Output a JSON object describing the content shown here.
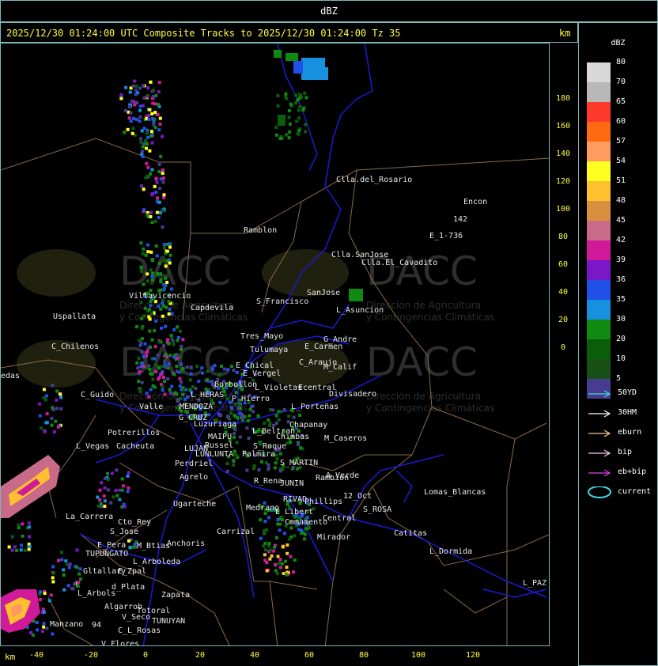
{
  "window": {
    "title": "dBZ"
  },
  "header": {
    "text": "2025/12/30 01:24:00 UTC Composite Tracks to 2025/12/30 01:24:00 Tz 35",
    "km_label": "km"
  },
  "axes": {
    "km_label_bottom": "km",
    "x_ticks": [
      "-40",
      "-20",
      "0",
      "20",
      "40",
      "60",
      "80",
      "100",
      "120"
    ],
    "y_ticks": [
      "180",
      "160",
      "140",
      "120",
      "100",
      "80",
      "60",
      "40",
      "20",
      "0"
    ]
  },
  "legend": {
    "title": "dBZ",
    "levels": [
      {
        "label": "80",
        "color": "#d8d8d8"
      },
      {
        "label": "70",
        "color": "#b8b8b8"
      },
      {
        "label": "65",
        "color": "#ff3a2a"
      },
      {
        "label": "60",
        "color": "#ff6a10"
      },
      {
        "label": "57",
        "color": "#ff9a60"
      },
      {
        "label": "54",
        "color": "#ffff20"
      },
      {
        "label": "51",
        "color": "#ffc030"
      },
      {
        "label": "48",
        "color": "#d89040"
      },
      {
        "label": "45",
        "color": "#c86a88"
      },
      {
        "label": "42",
        "color": "#d01a9a"
      },
      {
        "label": "39",
        "color": "#7a18c8"
      },
      {
        "label": "36",
        "color": "#2050e8"
      },
      {
        "label": "35",
        "color": "#1890e0"
      },
      {
        "label": "30",
        "color": "#108a10"
      },
      {
        "label": "20",
        "color": "#0a5e0a"
      },
      {
        "label": "10",
        "color": "#185018"
      },
      {
        "label": "5",
        "color": "#483c90"
      }
    ],
    "tracks": [
      {
        "label": "50YD",
        "color": "#40d8e0",
        "icon": "arrow-right-icon"
      },
      {
        "label": "30HM",
        "color": "#ffffff",
        "icon": "arrow-right-icon"
      },
      {
        "label": "eburn",
        "color": "#f0c890",
        "icon": "arrow-right-icon"
      },
      {
        "label": "bip",
        "color": "#ffc8e8",
        "icon": "arrow-right-icon"
      },
      {
        "label": "eb+bip",
        "color": "#e040e0",
        "icon": "arrow-right-icon"
      },
      {
        "label": "current",
        "color": "#40d8e0",
        "icon": "ellipse-icon"
      }
    ]
  },
  "watermark": {
    "brand": "DACC",
    "subtitle_line1": "Dirección de Agricultura",
    "subtitle_line2": "y Contingencias Climáticas"
  },
  "places": [
    "Clla.del_Rosario",
    "Encon",
    "142",
    "E_1-736",
    "Ramblon",
    "Clla.SanJose",
    "Clla.El_Cavadito",
    "Villavicencio",
    "Capdevila",
    "S_Francisco",
    "SanJose",
    "L_Asuncion",
    "Uspallata",
    "Tres_Mayo",
    "G_Andre",
    "C_Chilenos",
    "Tulumaya",
    "E_Carmen",
    "E_Chical",
    "C_Araujo",
    "M_Calif",
    "E_Vergel",
    "Borbollon",
    "L_Violetas",
    "Ecentral",
    "Divisadero",
    "edas",
    "C_Guido",
    "L_HERAS",
    "P_Hierro",
    "MENDOZA",
    "Valle",
    "L_Porteñas",
    "G_CRUZ",
    "Luzuriaga",
    "Chapanay",
    "L_Beltran",
    "MAIPU",
    "Chimbas",
    "M_Caseros",
    "Potrerillos",
    "Russel",
    "L_Vegas",
    "Cacheuta",
    "LUJAN",
    "LUNLUNTA",
    "S_Roque",
    "Palmira",
    "Perdriel",
    "S_MARTIN",
    "A_Verde",
    "Rambion",
    "Agrelo",
    "R_Rena",
    "JUNIN",
    "Lomas_Blancas",
    "Ugarteche",
    "RIVAD",
    "Phillips",
    "12_Oct",
    "S_ROSA",
    "La_Carrera",
    "Cto_Rey",
    "Medrano",
    "E_Libert",
    "Central",
    "S_Jose",
    "Carrizal",
    "Cmmamento",
    "Catitas",
    "E_Pera",
    "M_Btias",
    "Anchoris",
    "TUPUNGATO",
    "Mirador",
    "L_Dormida",
    "L_Arboleda",
    "Gltallary",
    "E_Zpal",
    "d_Plata",
    "L_PAZ",
    "L_Arbols",
    "Zapata",
    "Algarrob",
    "Totoral",
    "V_Seco",
    "Manzano",
    "TUNUYAN",
    "C_L_Rosas",
    "V_Flores",
    "94"
  ]
}
